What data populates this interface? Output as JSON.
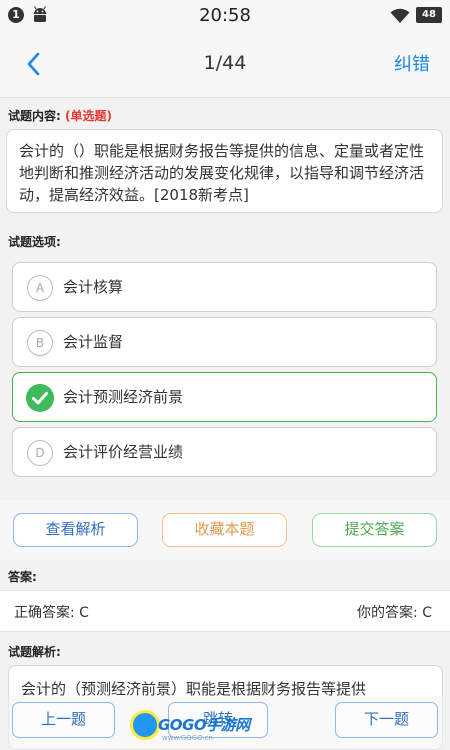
{
  "status_bar": {
    "notification_count": "1",
    "time": "20:58",
    "battery": "48"
  },
  "nav": {
    "progress": "1/44",
    "report_label": "纠错"
  },
  "question": {
    "label": "试题内容:",
    "type_tag": "(单选题)",
    "text": "会计的（）职能是根据财务报告等提供的信息、定量或者定性地判断和推测经济活动的发展变化规律，以指导和调节经济活动，提高经济效益。[2018新考点]"
  },
  "options": {
    "label": "试题选项:",
    "items": [
      {
        "letter": "A",
        "text": "会计核算",
        "selected": false
      },
      {
        "letter": "B",
        "text": "会计监督",
        "selected": false
      },
      {
        "letter": "C",
        "text": "会计预测经济前景",
        "selected": true
      },
      {
        "letter": "D",
        "text": "会计评价经营业绩",
        "selected": false
      }
    ]
  },
  "actions": {
    "view_explanation": "查看解析",
    "favorite": "收藏本题",
    "submit": "提交答案"
  },
  "answer": {
    "label": "答案:",
    "correct": "正确答案: C",
    "yours": "你的答案: C"
  },
  "explanation": {
    "label": "试题解析:",
    "text": "会计的（预测经济前景）职能是根据财务报告等提供"
  },
  "bottom": {
    "prev": "上一题",
    "jump": "跳转",
    "next": "下一题"
  },
  "watermark": {
    "brand": "GOGO手游网",
    "url": "www.GOGO.cn"
  },
  "colors": {
    "accent": "#1e88e5",
    "correct": "#3dbb5d",
    "favorite": "#e59a4f",
    "type_tag": "#e53935"
  }
}
